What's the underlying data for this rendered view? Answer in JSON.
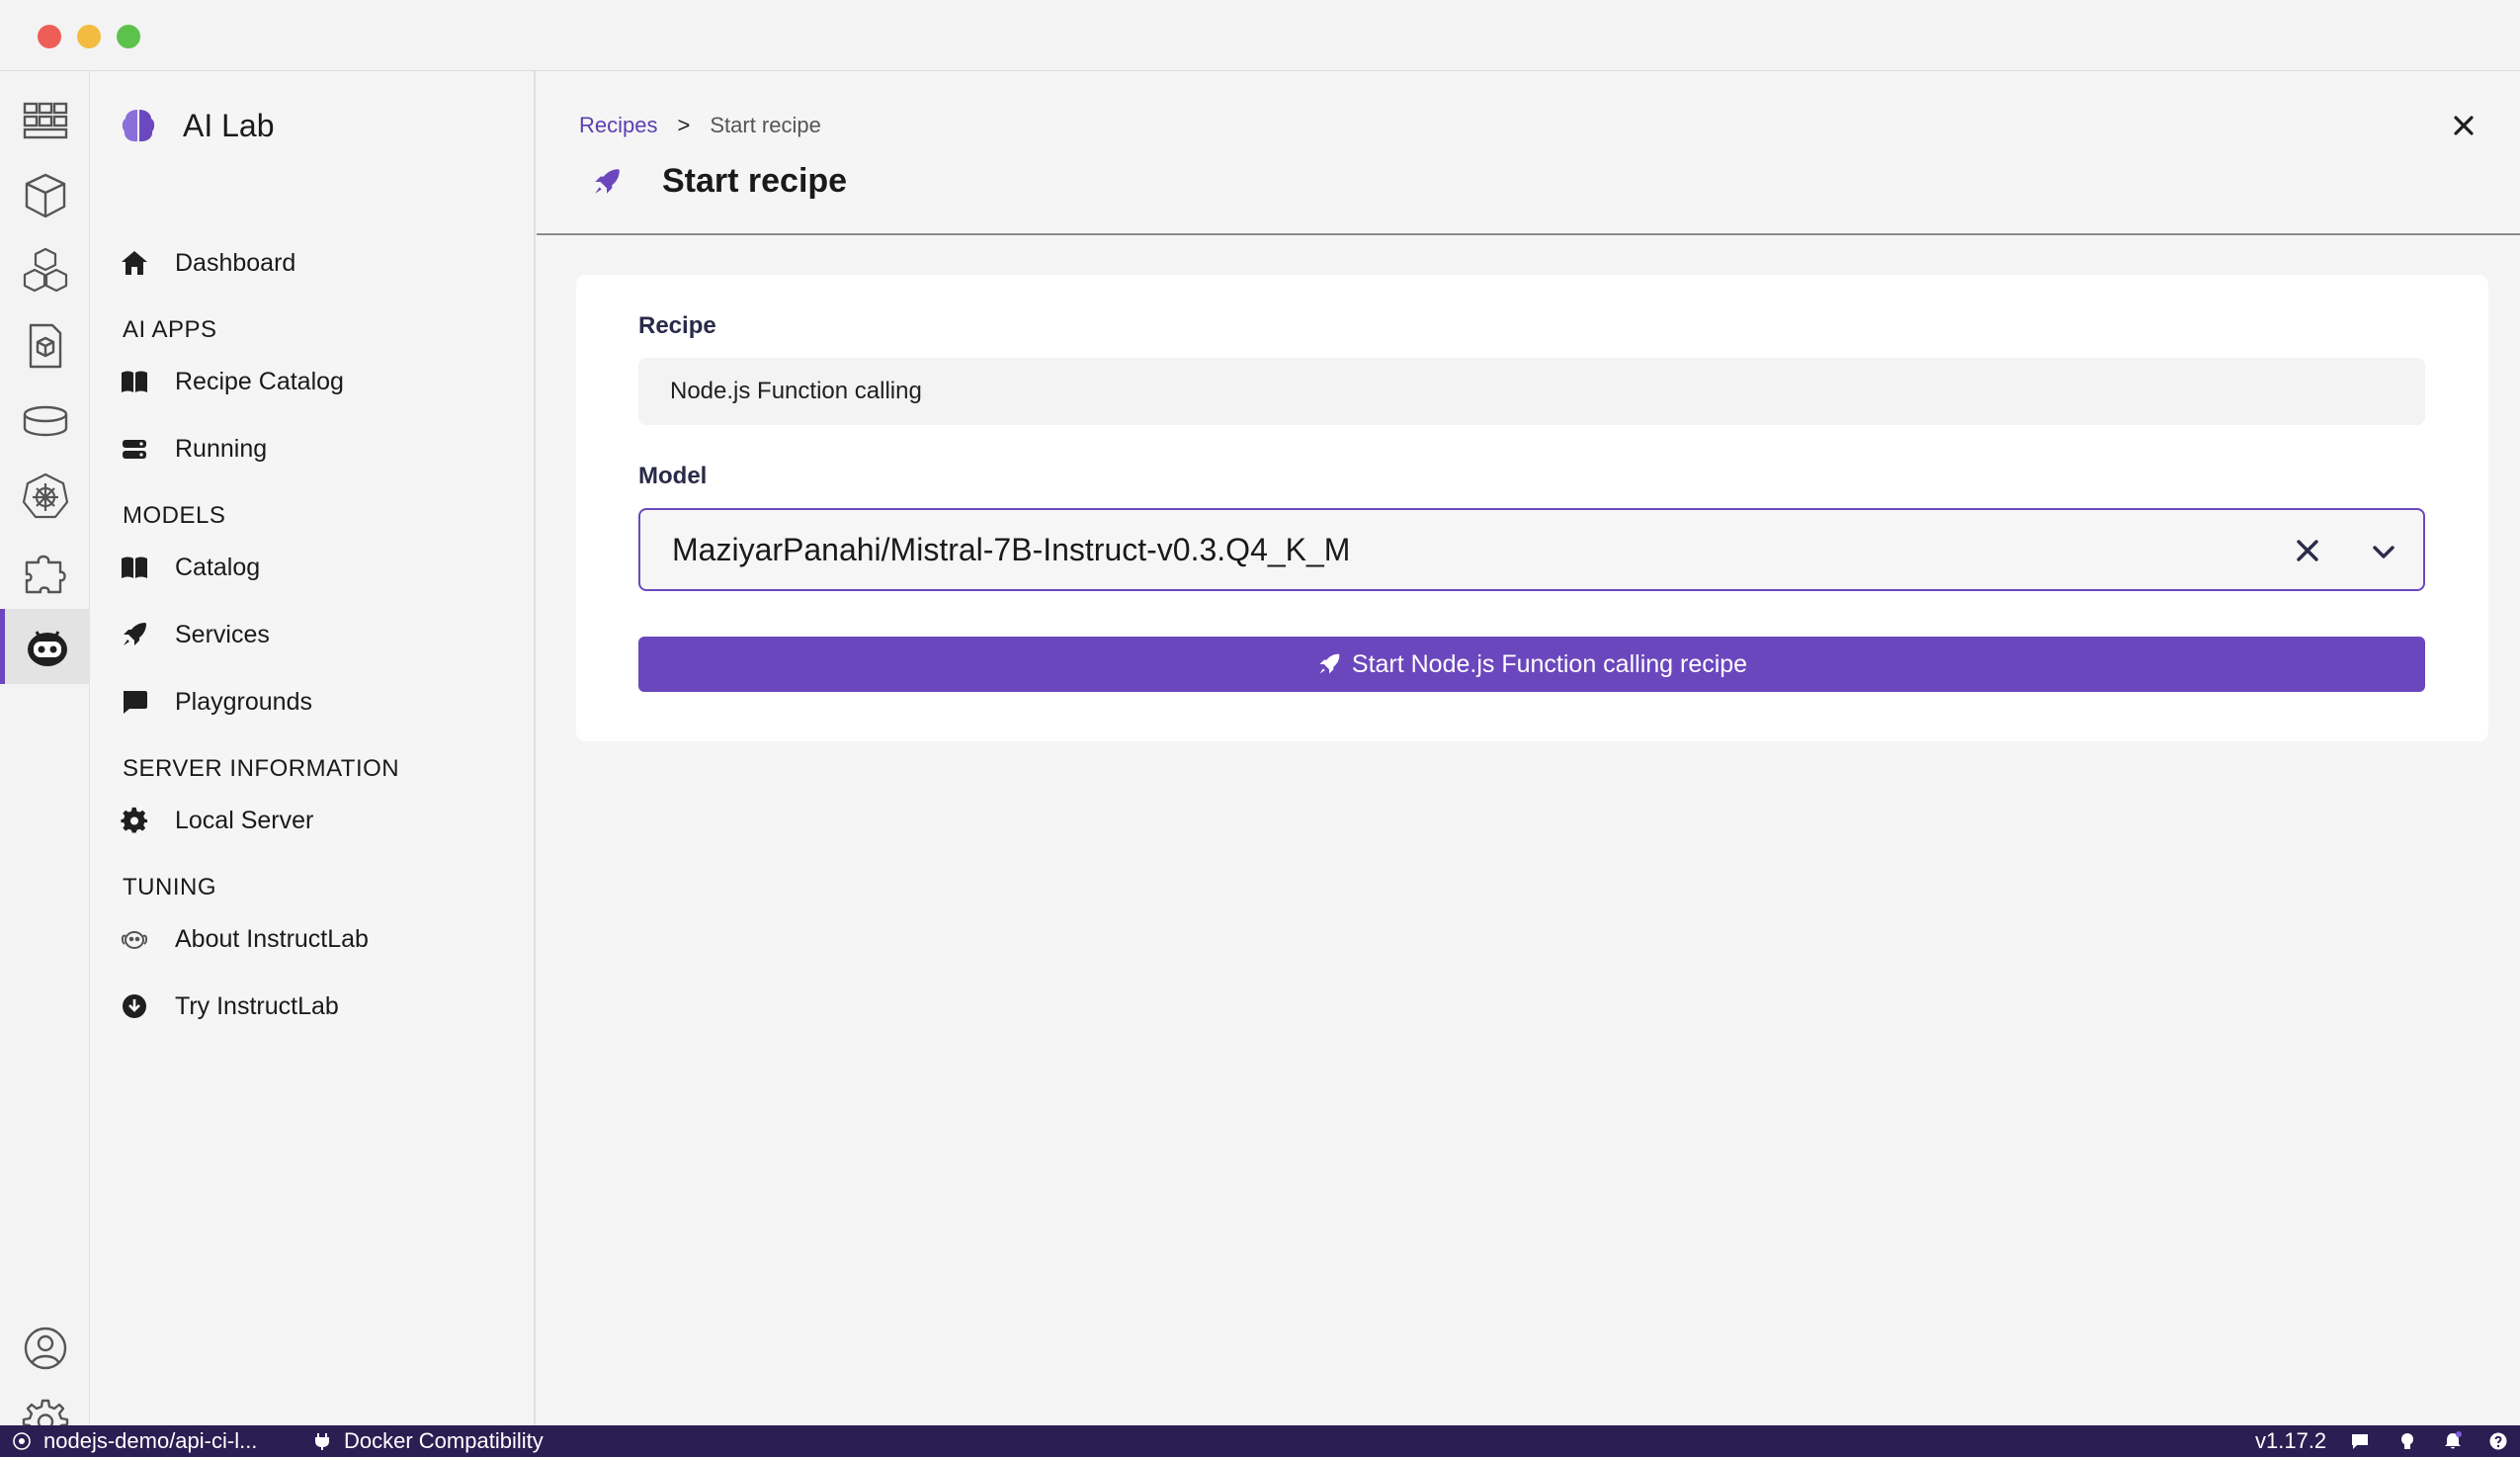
{
  "sidebar": {
    "brand": "AI Lab",
    "dashboard": "Dashboard",
    "section_ai_apps": "AI APPS",
    "recipe_catalog": "Recipe Catalog",
    "running": "Running",
    "section_models": "MODELS",
    "catalog": "Catalog",
    "services": "Services",
    "playgrounds": "Playgrounds",
    "section_server": "SERVER INFORMATION",
    "local_server": "Local Server",
    "section_tuning": "TUNING",
    "about_instructlab": "About InstructLab",
    "try_instructlab": "Try InstructLab"
  },
  "breadcrumb": {
    "parent": "Recipes",
    "separator": ">",
    "current": "Start recipe"
  },
  "page": {
    "title": "Start recipe"
  },
  "form": {
    "recipe_label": "Recipe",
    "recipe_value": "Node.js Function calling",
    "model_label": "Model",
    "model_value": "MaziyarPanahi/Mistral-7B-Instruct-v0.3.Q4_K_M",
    "start_button": "Start Node.js Function calling recipe"
  },
  "statusbar": {
    "context": "nodejs-demo/api-ci-l...",
    "engine": "Docker Compatibility",
    "version": "v1.17.2"
  },
  "colors": {
    "accent": "#6b47bd",
    "statusbar": "#2b1e53",
    "link": "#5b3fb0"
  }
}
